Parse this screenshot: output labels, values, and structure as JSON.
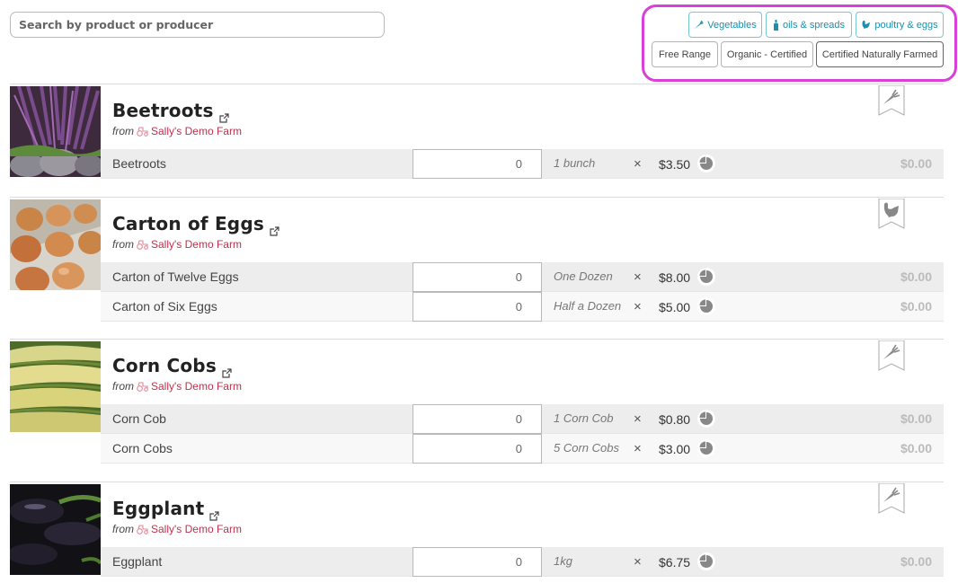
{
  "search": {
    "placeholder": "Search by product or producer",
    "value": ""
  },
  "filters": {
    "taxons": [
      {
        "label": "Vegetables",
        "icon": "carrot-icon"
      },
      {
        "label": "oils & spreads",
        "icon": "bottle-icon"
      },
      {
        "label": "poultry & eggs",
        "icon": "chicken-icon"
      }
    ],
    "properties": [
      {
        "label": "Free Range"
      },
      {
        "label": "Organic - Certified"
      },
      {
        "label": "Certified Naturally Farmed"
      }
    ],
    "highlight_color": "#d93fd9"
  },
  "products": [
    {
      "name": "Beetroots",
      "from": "from",
      "producer": "Sally's Demo Farm",
      "category_icon": "carrot-icon",
      "variants": [
        {
          "name": "Beetroots",
          "qty": "0",
          "unit": "1 bunch",
          "times": "×",
          "price": "$3.50",
          "total": "$0.00"
        }
      ]
    },
    {
      "name": "Carton of Eggs",
      "from": "from",
      "producer": "Sally's Demo Farm",
      "category_icon": "chicken-icon",
      "variants": [
        {
          "name": "Carton of Twelve Eggs",
          "qty": "0",
          "unit": "One Dozen",
          "times": "×",
          "price": "$8.00",
          "total": "$0.00"
        },
        {
          "name": "Carton of Six Eggs",
          "qty": "0",
          "unit": "Half a Dozen",
          "times": "×",
          "price": "$5.00",
          "total": "$0.00"
        }
      ]
    },
    {
      "name": "Corn Cobs",
      "from": "from",
      "producer": "Sally's Demo Farm",
      "category_icon": "carrot-icon",
      "variants": [
        {
          "name": "Corn Cob",
          "qty": "0",
          "unit": "1 Corn Cob",
          "times": "×",
          "price": "$0.80",
          "total": "$0.00"
        },
        {
          "name": "Corn Cobs",
          "qty": "0",
          "unit": "5 Corn Cobs",
          "times": "×",
          "price": "$3.00",
          "total": "$0.00"
        }
      ]
    },
    {
      "name": "Eggplant",
      "from": "from",
      "producer": "Sally's Demo Farm",
      "category_icon": "carrot-icon",
      "variants": [
        {
          "name": "Eggplant",
          "qty": "0",
          "unit": "1kg",
          "times": "×",
          "price": "$6.75",
          "total": "$0.00"
        }
      ]
    }
  ]
}
